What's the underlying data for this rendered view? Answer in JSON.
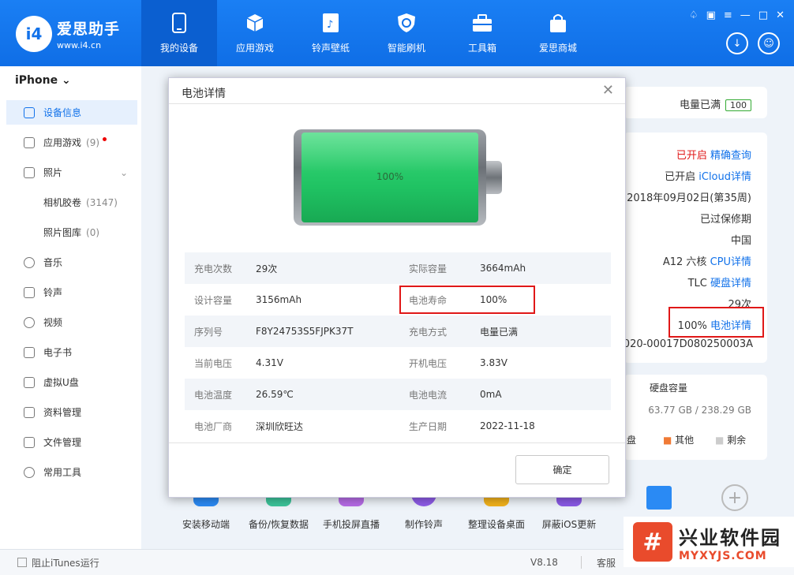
{
  "app": {
    "name": "爱思助手",
    "url": "www.i4.cn",
    "logo_text": "i4"
  },
  "nav": [
    {
      "label": "我的设备",
      "icon": "phone-icon"
    },
    {
      "label": "应用游戏",
      "icon": "cube-icon"
    },
    {
      "label": "铃声壁纸",
      "icon": "music-file-icon"
    },
    {
      "label": "智能刷机",
      "icon": "shield-refresh-icon"
    },
    {
      "label": "工具箱",
      "icon": "toolbox-icon"
    },
    {
      "label": "爱思商城",
      "icon": "shopping-bag-icon"
    }
  ],
  "sidebar": {
    "device": "iPhone",
    "items": [
      {
        "label": "设备信息"
      },
      {
        "label": "应用游戏",
        "count": "(9)"
      },
      {
        "label": "照片"
      },
      {
        "label": "相机胶卷",
        "count": "(3147)"
      },
      {
        "label": "照片图库",
        "count": "(0)"
      },
      {
        "label": "音乐"
      },
      {
        "label": "铃声"
      },
      {
        "label": "视频"
      },
      {
        "label": "电子书"
      },
      {
        "label": "虚拟U盘"
      },
      {
        "label": "资料管理"
      },
      {
        "label": "文件管理"
      },
      {
        "label": "常用工具"
      }
    ]
  },
  "status": {
    "itunes": "阻止iTunes运行",
    "version": "V8.18",
    "service": "客服"
  },
  "right_panel": {
    "charge_label": "电量已满",
    "charge_value": "100",
    "rows": [
      {
        "value": "已开启",
        "link": "精确查询"
      },
      {
        "value": "已开启",
        "link": "iCloud详情"
      },
      {
        "value": "2018年09月02日(第35周)"
      },
      {
        "value": "已过保修期"
      },
      {
        "value": "中国"
      },
      {
        "value": "A12 六核",
        "link": "CPU详情"
      },
      {
        "value": "TLC",
        "link": "硬盘详情"
      },
      {
        "value": "29次"
      },
      {
        "value": "100%",
        "link": "电池详情"
      },
      {
        "value": "020-00017D080250003A"
      }
    ],
    "disk_title": "硬盘容量",
    "disk_size": "63.77 GB / 238.29 GB",
    "legend": [
      "盘",
      "其他",
      "剩余"
    ]
  },
  "tools": [
    {
      "label": "安装移动端"
    },
    {
      "label": "备份/恢复数据"
    },
    {
      "label": "手机投屏直播"
    },
    {
      "label": "制作铃声"
    },
    {
      "label": "整理设备桌面"
    },
    {
      "label": "屏蔽iOS更新"
    }
  ],
  "dialog": {
    "title": "电池详情",
    "battery_percent": "100%",
    "battery_level": 1.0,
    "rows": [
      {
        "k1": "充电次数",
        "v1": "29次",
        "k2": "实际容量",
        "v2": "3664mAh"
      },
      {
        "k1": "设计容量",
        "v1": "3156mAh",
        "k2": "电池寿命",
        "v2": "100%"
      },
      {
        "k1": "序列号",
        "v1": "F8Y24753S5FJPK37T",
        "k2": "充电方式",
        "v2": "电量已满"
      },
      {
        "k1": "当前电压",
        "v1": "4.31V",
        "k2": "开机电压",
        "v2": "3.83V"
      },
      {
        "k1": "电池温度",
        "v1": "26.59℃",
        "k2": "电池电流",
        "v2": "0mA"
      },
      {
        "k1": "电池厂商",
        "v1": "深圳欣旺达",
        "k2": "生产日期",
        "v2": "2022-11-18"
      }
    ],
    "ok": "确定"
  },
  "watermark": {
    "logo": "#",
    "cn": "兴业软件园",
    "en": "MYXYJS.COM"
  }
}
